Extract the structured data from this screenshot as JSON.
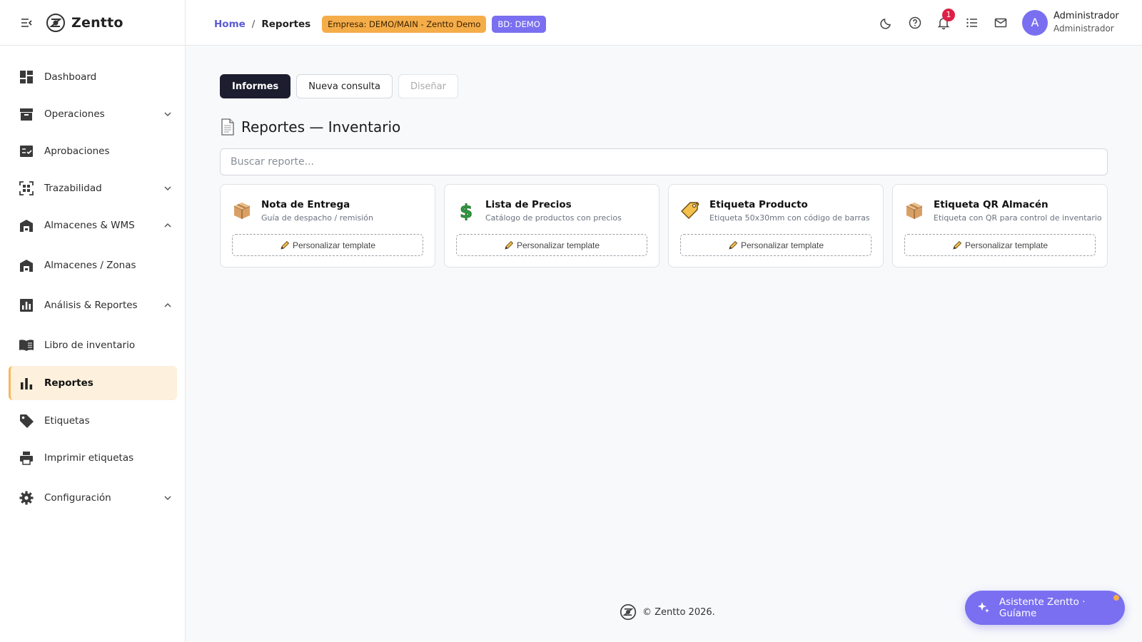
{
  "brand": {
    "name": "Zentto"
  },
  "sidebar": {
    "items": [
      {
        "label": "Dashboard"
      },
      {
        "label": "Operaciones"
      },
      {
        "label": "Aprobaciones"
      },
      {
        "label": "Trazabilidad"
      },
      {
        "label": "Almacenes & WMS"
      },
      {
        "label": "Almacenes / Zonas"
      },
      {
        "label": "Análisis & Reportes"
      },
      {
        "label": "Libro de inventario"
      },
      {
        "label": "Reportes"
      },
      {
        "label": "Etiquetas"
      },
      {
        "label": "Imprimir etiquetas"
      },
      {
        "label": "Configuración"
      }
    ]
  },
  "header": {
    "breadcrumb": {
      "home": "Home",
      "separator": "/",
      "current": "Reportes"
    },
    "empresa_badge": "Empresa: DEMO/MAIN - Zentto Demo",
    "bd_badge": "BD: DEMO",
    "notification_count": "1",
    "user": {
      "initial": "A",
      "name": "Administrador",
      "role": "Administrador"
    }
  },
  "tabs": [
    {
      "label": "Informes"
    },
    {
      "label": "Nueva consulta"
    },
    {
      "label": "Diseñar"
    }
  ],
  "page": {
    "title": "Reportes — Inventario",
    "search_placeholder": "Buscar reporte..."
  },
  "cards": [
    {
      "title": "Nota de Entrega",
      "description": "Guía de despacho / remisión",
      "button": "Personalizar template",
      "icon": "package-icon"
    },
    {
      "title": "Lista de Precios",
      "description": "Catálogo de productos con precios",
      "button": "Personalizar template",
      "icon": "dollar-icon"
    },
    {
      "title": "Etiqueta Producto",
      "description": "Etiqueta 50x30mm con código de barras",
      "button": "Personalizar template",
      "icon": "tag-icon"
    },
    {
      "title": "Etiqueta QR Almacén",
      "description": "Etiqueta con QR para control de inventario",
      "button": "Personalizar template",
      "icon": "package-icon"
    }
  ],
  "footer": {
    "text": "© Zentto 2026."
  },
  "assistant": {
    "label": "Asistente Zentto · Guíame"
  },
  "colors": {
    "accent": "#7a6ff0",
    "active_nav_bg": "#fdf0dc",
    "active_nav_border": "#f4b860",
    "empresa_badge": "#f5ad4a",
    "notification": "#dc2047",
    "dark_tab": "#1c1d2e"
  }
}
